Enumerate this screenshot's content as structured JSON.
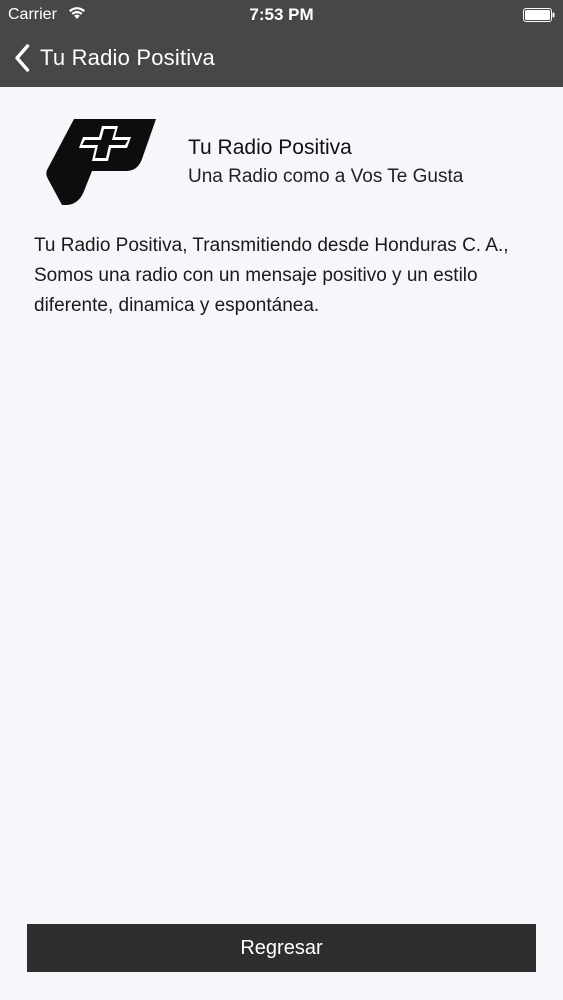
{
  "status_bar": {
    "carrier": "Carrier",
    "time": "7:53 PM",
    "wifi_icon": "wifi-icon",
    "battery_icon": "battery-icon"
  },
  "nav": {
    "back_icon": "chevron-left-icon",
    "title": "Tu Radio Positiva"
  },
  "station": {
    "logo_icon": "radio-positiva-logo",
    "name": "Tu Radio Positiva",
    "slogan": "Una Radio como a Vos Te Gusta"
  },
  "description": "Tu Radio Positiva, Transmitiendo desde Honduras C. A., Somos una radio con un mensaje positivo y un estilo diferente, dinamica y espontánea.",
  "footer": {
    "button_label": "Regresar"
  },
  "colors": {
    "header_background": "#474747",
    "page_background": "#f6f6fb",
    "button_background": "#2e2e2e",
    "text_light": "#ffffff"
  }
}
